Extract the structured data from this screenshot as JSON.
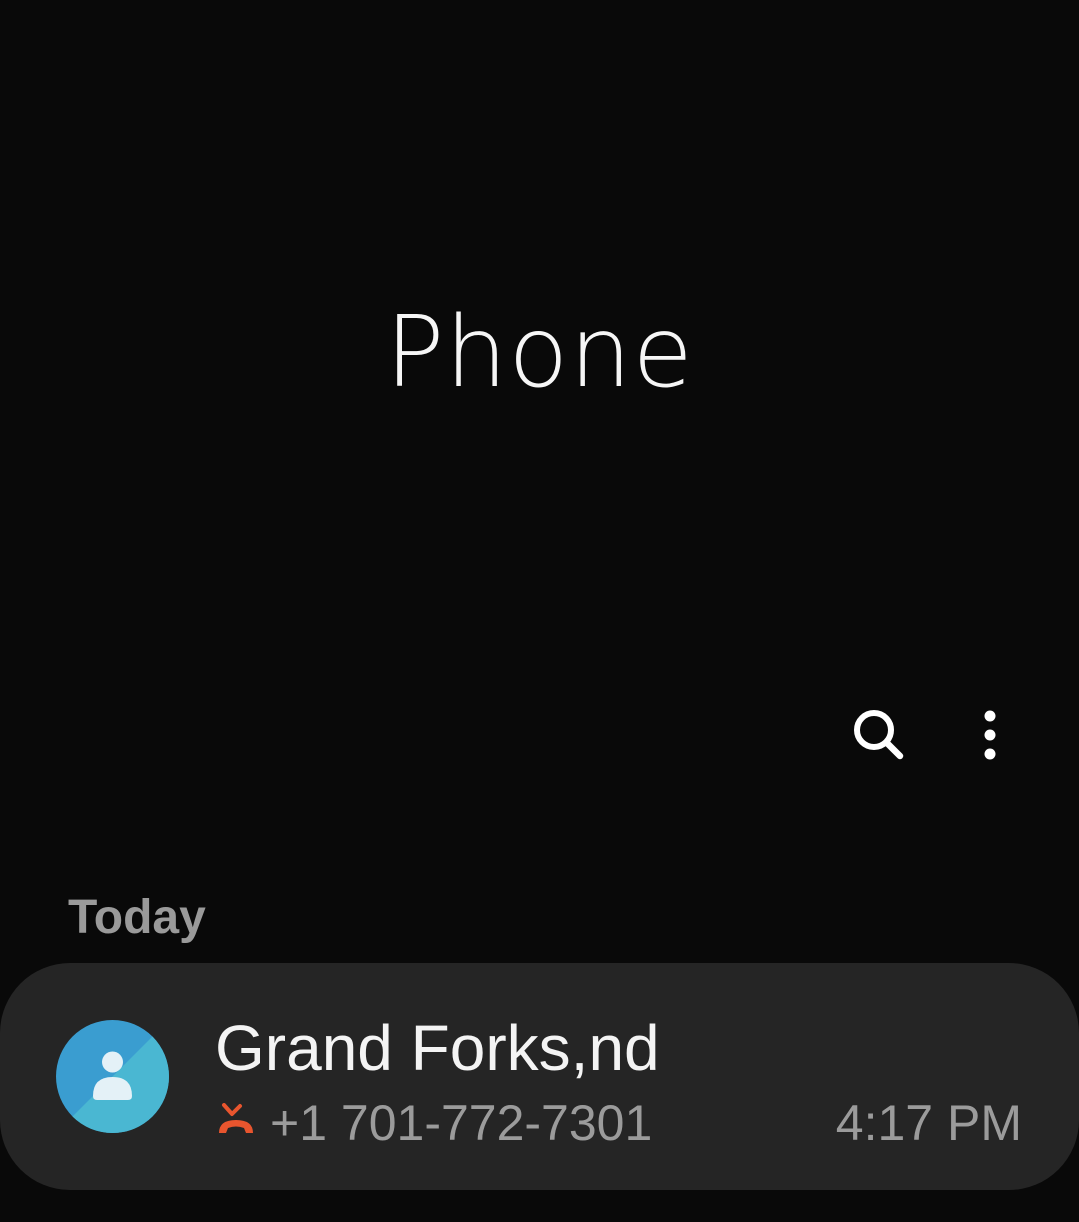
{
  "header": {
    "title": "Phone"
  },
  "toolbar": {
    "search_icon": "search-icon",
    "more_icon": "more-options-icon"
  },
  "call_log": {
    "section_label": "Today",
    "entries": [
      {
        "name": "Grand Forks,nd",
        "number": "+1 701-772-7301",
        "time": "4:17 PM",
        "call_type_icon": "missed-call-icon",
        "avatar_icon": "person-icon"
      }
    ]
  },
  "colors": {
    "background": "#090909",
    "card": "#252525",
    "avatar_light": "#4ab7d2",
    "avatar_dark": "#3a9dd0",
    "missed_call": "#e8552e",
    "secondary_text": "#9b9b9b"
  }
}
